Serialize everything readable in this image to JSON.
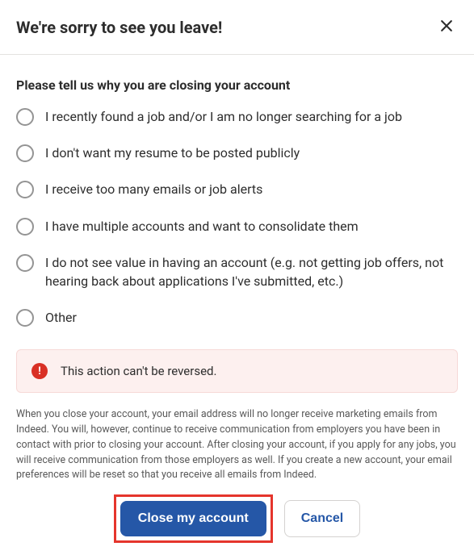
{
  "header": {
    "title": "We're sorry to see you leave!"
  },
  "question": "Please tell us why you are closing your account",
  "options": [
    "I recently found a job and/or I am no longer searching for a job",
    "I don't want my resume to be posted publicly",
    "I receive too many emails or job alerts",
    "I have multiple accounts and want to consolidate them",
    "I do not see value in having an account (e.g. not getting job offers, not hearing back about applications I've submitted, etc.)",
    "Other"
  ],
  "warning": {
    "icon": "!",
    "text": "This action can't be reversed."
  },
  "disclosure": "When you close your account, your email address will no longer receive marketing emails from Indeed. You will, however, continue to receive communication from employers you have been in contact with prior to closing your account. After closing your account, if you apply for any jobs, you will receive communication from those employers as well. If you create a new account, your email preferences will be reset so that you receive all emails from Indeed.",
  "buttons": {
    "primary": "Close my account",
    "secondary": "Cancel"
  }
}
